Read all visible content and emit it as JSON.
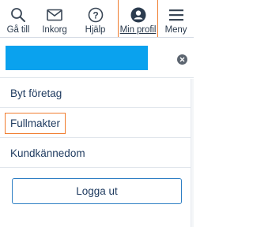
{
  "nav": {
    "goto_label": "Gå till",
    "inbox_label": "Inkorg",
    "help_label": "Hjälp",
    "profile_label": "Min profil",
    "menu_label": "Meny"
  },
  "icons": {
    "goto": "search-icon",
    "inbox": "mail-icon",
    "help": "help-icon",
    "profile": "user-icon",
    "menu": "hamburger-icon",
    "close": "close-icon"
  },
  "profile_menu": {
    "items": [
      {
        "label": "Byt företag"
      },
      {
        "label": "Fullmakter"
      },
      {
        "label": "Kundkännedom"
      }
    ],
    "logout_label": "Logga ut"
  },
  "colors": {
    "accent_orange": "#f07d2f",
    "name_highlight": "#0aa2ee",
    "text": "#1e3a5f",
    "button_border": "#2e7fc4"
  }
}
